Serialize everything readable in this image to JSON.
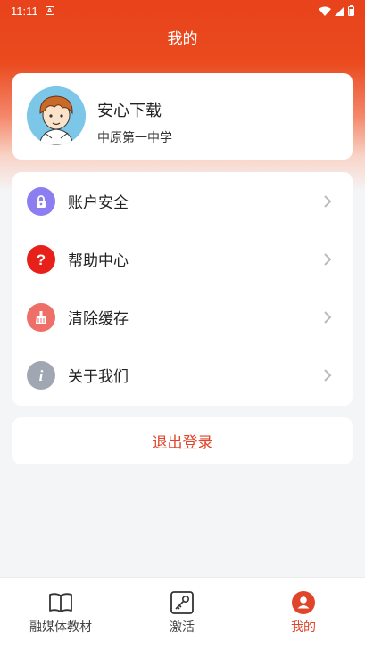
{
  "status_bar": {
    "time": "11:11"
  },
  "header": {
    "title": "我的"
  },
  "profile": {
    "name": "安心下载",
    "school": "中原第一中学"
  },
  "menu": {
    "items": [
      {
        "label": "账户安全",
        "icon": "lock-icon",
        "color": "#8c7ef0"
      },
      {
        "label": "帮助中心",
        "icon": "question-icon",
        "color": "#e8201a"
      },
      {
        "label": "清除缓存",
        "icon": "broom-icon",
        "color": "#ee6e68"
      },
      {
        "label": "关于我们",
        "icon": "info-icon",
        "color": "#a1a7b2"
      }
    ]
  },
  "logout": {
    "label": "退出登录"
  },
  "tabbar": {
    "tabs": [
      {
        "label": "融媒体教材",
        "icon": "book-icon"
      },
      {
        "label": "激活",
        "icon": "key-icon"
      },
      {
        "label": "我的",
        "icon": "person-icon",
        "active": true
      }
    ]
  },
  "colors": {
    "accent": "#e0442b",
    "header": "#e8431c"
  }
}
